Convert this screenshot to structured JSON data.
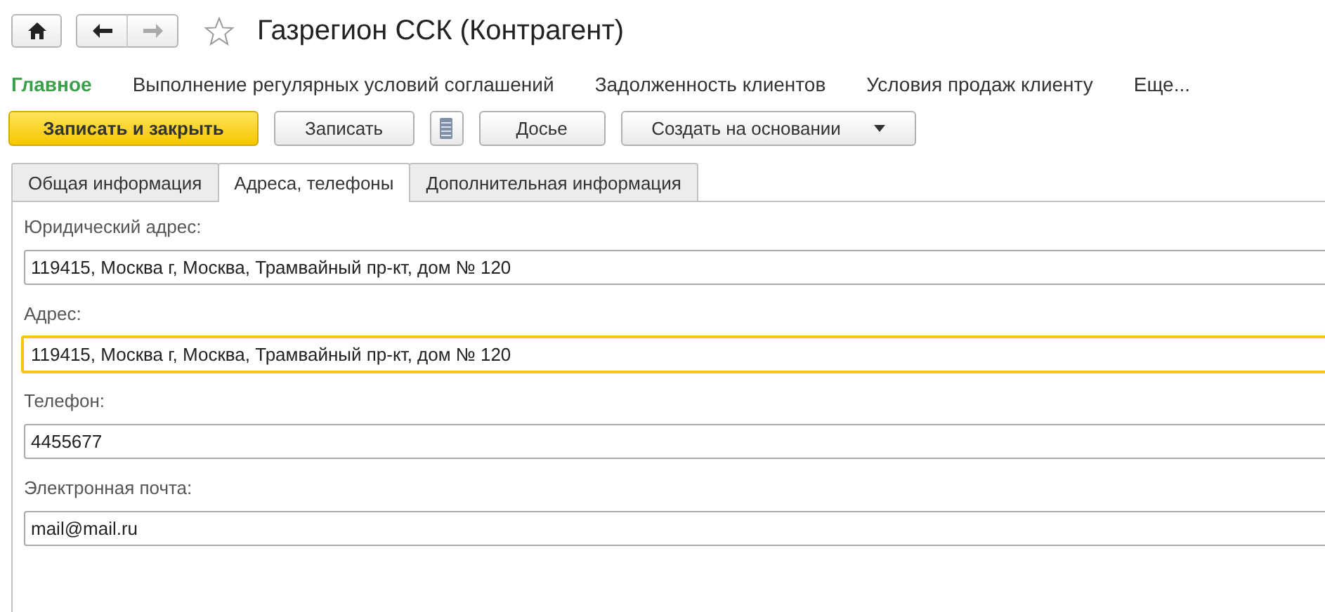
{
  "window": {
    "title": "Газрегион ССК (Контрагент)",
    "favorite": false
  },
  "nav": [
    {
      "label": "Главное",
      "selected": true
    },
    {
      "label": "Выполнение регулярных условий соглашений",
      "selected": false
    },
    {
      "label": "Задолженность клиентов",
      "selected": false
    },
    {
      "label": "Условия продаж клиенту",
      "selected": false
    },
    {
      "label": "Еще...",
      "selected": false
    }
  ],
  "buttons": [
    {
      "kind": "primary",
      "label": "Записать и закрыть"
    },
    {
      "kind": "normal",
      "label": "Записать"
    },
    {
      "kind": "icon"
    },
    {
      "kind": "normal",
      "label": "Досье"
    },
    {
      "kind": "dropdown",
      "label": "Создать на основании"
    }
  ],
  "tabs": [
    {
      "label": "Общая информация",
      "selected": false
    },
    {
      "label": "Адреса, телефоны",
      "selected": true
    },
    {
      "label": "Дополнительная информация",
      "selected": false
    }
  ],
  "fields": [
    {
      "label": "Юридический адрес:",
      "value": "119415, Москва г, Москва, Трамвайный пр-кт, дом № 120",
      "focused": false
    },
    {
      "label": "Адрес:",
      "value": "119415, Москва г, Москва, Трамвайный пр-кт, дом № 120",
      "focused": true
    },
    {
      "label": "Телефон:",
      "value": "4455677",
      "focused": false
    },
    {
      "label": "Электронная почта:",
      "value": "mail@mail.ru",
      "focused": false
    }
  ]
}
